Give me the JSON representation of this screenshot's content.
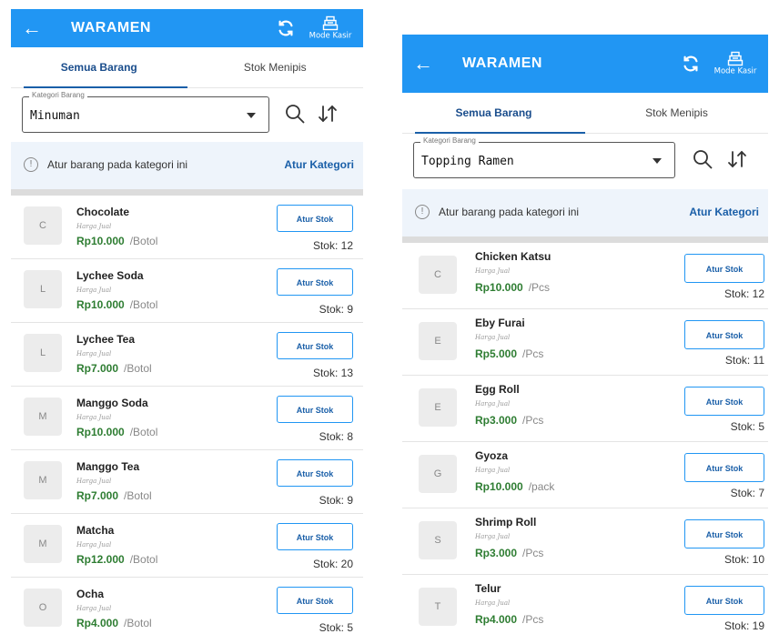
{
  "screens": [
    {
      "app_title": "WARAMEN",
      "mode_kasir": "Mode Kasir",
      "tabs": [
        "Semua Barang",
        "Stok Menipis"
      ],
      "category_label": "Kategori Barang",
      "category_value": "Minuman",
      "notice": "Atur barang pada kategori ini",
      "notice_link": "Atur Kategori",
      "items": [
        {
          "initial": "C",
          "name": "Chocolate",
          "label": "Harga Jual",
          "price": "Rp10.000",
          "unit": "/Botol",
          "button": "Atur Stok",
          "stock": "Stok: 12"
        },
        {
          "initial": "L",
          "name": "Lychee Soda",
          "label": "Harga Jual",
          "price": "Rp10.000",
          "unit": "/Botol",
          "button": "Atur Stok",
          "stock": "Stok: 9"
        },
        {
          "initial": "L",
          "name": "Lychee Tea",
          "label": "Harga Jual",
          "price": "Rp7.000",
          "unit": "/Botol",
          "button": "Atur Stok",
          "stock": "Stok: 13"
        },
        {
          "initial": "M",
          "name": "Manggo Soda",
          "label": "Harga Jual",
          "price": "Rp10.000",
          "unit": "/Botol",
          "button": "Atur Stok",
          "stock": "Stok: 8"
        },
        {
          "initial": "M",
          "name": "Manggo Tea",
          "label": "Harga Jual",
          "price": "Rp7.000",
          "unit": "/Botol",
          "button": "Atur Stok",
          "stock": "Stok: 9"
        },
        {
          "initial": "M",
          "name": "Matcha",
          "label": "Harga Jual",
          "price": "Rp12.000",
          "unit": "/Botol",
          "button": "Atur Stok",
          "stock": "Stok: 20"
        },
        {
          "initial": "O",
          "name": "Ocha",
          "label": "Harga Jual",
          "price": "Rp4.000",
          "unit": "/Botol",
          "button": "Atur Stok",
          "stock": "Stok: 5"
        }
      ]
    },
    {
      "app_title": "WARAMEN",
      "mode_kasir": "Mode Kasir",
      "tabs": [
        "Semua Barang",
        "Stok Menipis"
      ],
      "category_label": "Kategori Barang",
      "category_value": "Topping Ramen",
      "notice": "Atur barang pada kategori ini",
      "notice_link": "Atur Kategori",
      "items": [
        {
          "initial": "C",
          "name": "Chicken Katsu",
          "label": "Harga Jual",
          "price": "Rp10.000",
          "unit": "/Pcs",
          "button": "Atur Stok",
          "stock": "Stok: 12"
        },
        {
          "initial": "E",
          "name": "Eby Furai",
          "label": "Harga Jual",
          "price": "Rp5.000",
          "unit": "/Pcs",
          "button": "Atur Stok",
          "stock": "Stok: 11"
        },
        {
          "initial": "E",
          "name": "Egg Roll",
          "label": "Harga Jual",
          "price": "Rp3.000",
          "unit": "/Pcs",
          "button": "Atur Stok",
          "stock": "Stok: 5"
        },
        {
          "initial": "G",
          "name": "Gyoza",
          "label": "Harga Jual",
          "price": "Rp10.000",
          "unit": "/pack",
          "button": "Atur Stok",
          "stock": "Stok: 7"
        },
        {
          "initial": "S",
          "name": "Shrimp Roll",
          "label": "Harga Jual",
          "price": "Rp3.000",
          "unit": "/Pcs",
          "button": "Atur Stok",
          "stock": "Stok: 10"
        },
        {
          "initial": "T",
          "name": "Telur",
          "label": "Harga Jual",
          "price": "Rp4.000",
          "unit": "/Pcs",
          "button": "Atur Stok",
          "stock": "Stok: 19"
        }
      ]
    }
  ],
  "icons": {
    "back": "arrow-left-icon",
    "sync": "sync-icon",
    "kasir": "cash-register-icon",
    "search": "search-icon",
    "sort": "sort-icon",
    "info": "info-icon",
    "dropdown": "chevron-down-icon"
  },
  "colors": {
    "appbar": "#2196f3",
    "accent": "#1a5fa8",
    "price": "#2e7d32",
    "notice_bg": "#eef4fb"
  }
}
